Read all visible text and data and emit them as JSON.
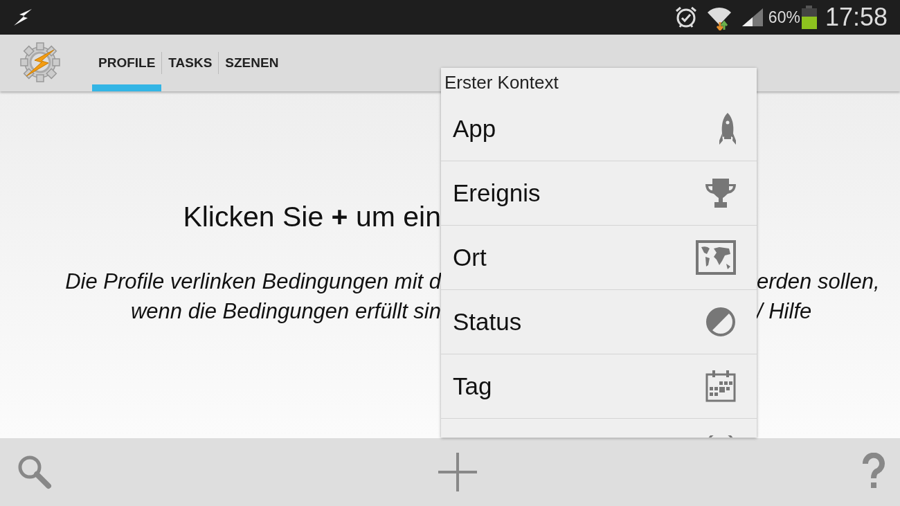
{
  "status_bar": {
    "time": "17:58",
    "battery_text": "60%"
  },
  "tabs": [
    {
      "label": "PROFILE",
      "selected": true
    },
    {
      "label": "TASKS",
      "selected": false
    },
    {
      "label": "SZENEN",
      "selected": false
    }
  ],
  "content": {
    "heading_left": "Klicken Sie **+** um ein",
    "line2_left": "Die Profile verlinken Bedingungen mit d",
    "line2_right": "erden sollen,",
    "line3_left": "wenn die Bedingungen erfüllt sin",
    "line3_right": "/ Hilfe"
  },
  "menu": {
    "title": "Erster Kontext",
    "items": [
      {
        "label": "App"
      },
      {
        "label": "Ereignis"
      },
      {
        "label": "Ort"
      },
      {
        "label": "Status"
      },
      {
        "label": "Tag"
      }
    ]
  }
}
